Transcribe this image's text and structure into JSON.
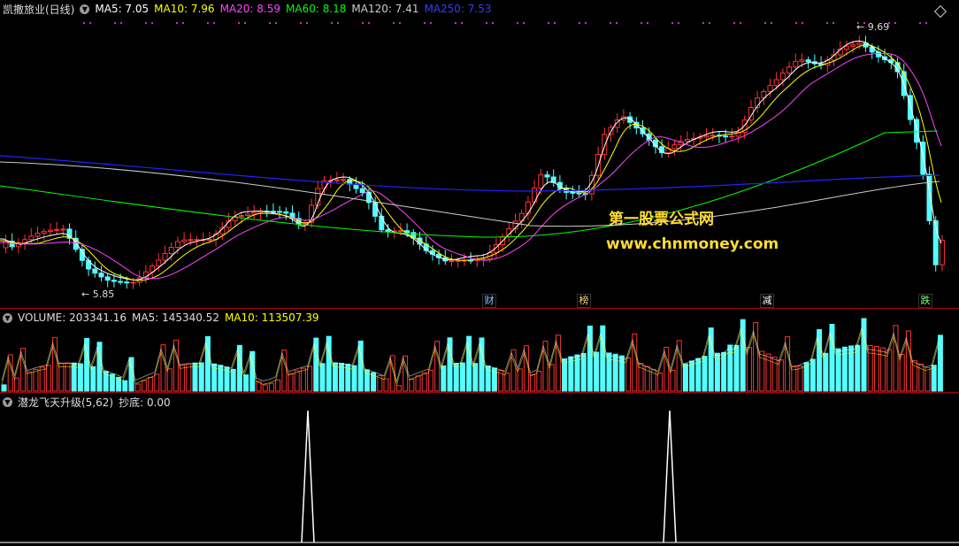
{
  "price_panel": {
    "stock_name": "凯撒旅业(日线)",
    "indicators": [
      {
        "label": "MA5: 7.05",
        "color": "#ffffff"
      },
      {
        "label": "MA10: 7.96",
        "color": "#ffff00"
      },
      {
        "label": "MA20: 8.59",
        "color": "#ff44ff"
      },
      {
        "label": "MA60: 8.18",
        "color": "#00ff00"
      },
      {
        "label": "MA120: 7.41",
        "color": "#cccccc"
      },
      {
        "label": "MA250: 7.53",
        "color": "#2222ff"
      }
    ],
    "high_label": "9.69",
    "low_label": "5.85",
    "events": [
      "财",
      "榜",
      "减",
      "跌"
    ]
  },
  "volume_panel": {
    "title": "VOLUME: 203341.16",
    "ma5": "MA5: 145340.52",
    "ma10": "MA10: 113507.39"
  },
  "indicator_panel": {
    "title": "潜龙飞天升级(5,62)",
    "value": "抄底: 0.00"
  },
  "watermark": {
    "line1": "第一股票公式网",
    "line2": "www.chnmoney.com"
  },
  "colors": {
    "up": "#ff3232",
    "down": "#54ffff",
    "ma5": "#ffffff",
    "ma10": "#ffff00",
    "ma20": "#ff44ff",
    "ma60": "#00ff00",
    "ma120": "#cccccc",
    "ma250": "#2222ff",
    "watermark": "#ffdc32"
  }
}
